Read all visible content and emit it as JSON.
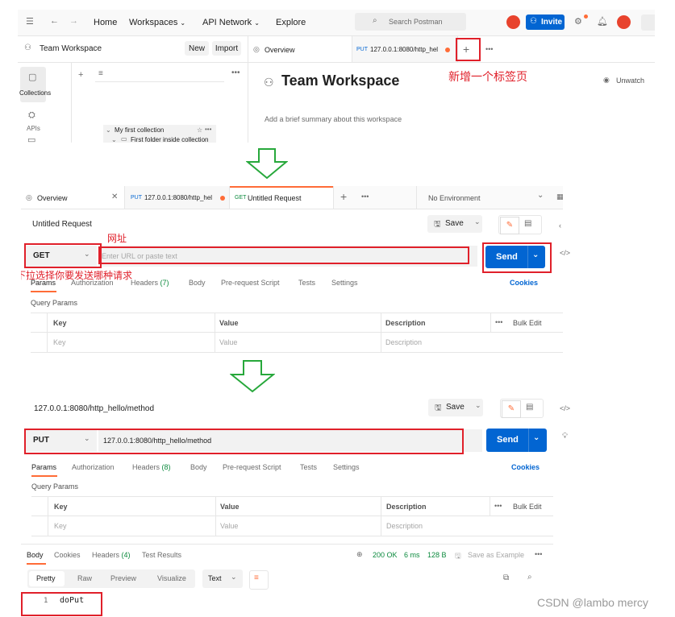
{
  "header": {
    "nav": [
      "Home",
      "Workspaces",
      "API Network",
      "Explore"
    ],
    "search_placeholder": "Search Postman",
    "invite_label": "Invite"
  },
  "sidebar": {
    "workspace_name": "Team Workspace",
    "new_label": "New",
    "import_label": "Import",
    "rail": [
      "Collections",
      "APIs"
    ],
    "tree": [
      "My first collection",
      "First folder inside collection"
    ]
  },
  "workspace_view": {
    "tab_overview": "Overview",
    "tab_put": "127.0.0.1:8080/http_hel",
    "title": "Team Workspace",
    "watch_label": "Unwatch",
    "summary_placeholder": "Add a brief summary about this workspace",
    "annotation_new_tab": "新增一个标签页"
  },
  "request_panel": {
    "tabs": [
      {
        "method": "",
        "label": "Overview"
      },
      {
        "method": "PUT",
        "label": "127.0.0.1:8080/http_hel"
      },
      {
        "method": "GET",
        "label": "Untitled Request"
      }
    ],
    "environment": "No Environment",
    "name": "Untitled Request",
    "save_label": "Save",
    "method": "GET",
    "url_placeholder": "Enter URL or paste text",
    "send_label": "Send",
    "subtabs": [
      "Params",
      "Authorization",
      "Headers",
      "Body",
      "Pre-request Script",
      "Tests",
      "Settings"
    ],
    "headers_count": "(7)",
    "cookies_label": "Cookies",
    "query_params_label": "Query Params",
    "columns": [
      "Key",
      "Value",
      "Description"
    ],
    "bulk_edit_label": "Bulk Edit",
    "row_placeholders": [
      "Key",
      "Value",
      "Description"
    ],
    "annotation_url": "网址",
    "annotation_method": "下拉选择你要发送哪种请求"
  },
  "response_panel": {
    "name": "127.0.0.1:8080/http_hello/method",
    "save_label": "Save",
    "method": "PUT",
    "url": "127.0.0.1:8080/http_hello/method",
    "send_label": "Send",
    "subtabs": [
      "Params",
      "Authorization",
      "Headers",
      "Body",
      "Pre-request Script",
      "Tests",
      "Settings"
    ],
    "headers_count": "(8)",
    "cookies_label": "Cookies",
    "query_params_label": "Query Params",
    "columns": [
      "Key",
      "Value",
      "Description"
    ],
    "bulk_edit_label": "Bulk Edit",
    "row_placeholders": [
      "Key",
      "Value",
      "Description"
    ],
    "resp_tabs": [
      "Body",
      "Cookies",
      "Headers",
      "Test Results"
    ],
    "resp_headers_count": "(4)",
    "status": "200 OK",
    "time": "6 ms",
    "size": "128 B",
    "save_example_label": "Save as Example",
    "view_modes": [
      "Pretty",
      "Raw",
      "Preview",
      "Visualize"
    ],
    "format": "Text",
    "line_number": "1",
    "body_text": "doPut"
  },
  "watermark": "CSDN @lambo mercy",
  "colors": {
    "accent": "#ff6c37",
    "send_blue": "#0265d2",
    "annotation_red": "#e0202a",
    "arrow_green": "#27a83b"
  }
}
